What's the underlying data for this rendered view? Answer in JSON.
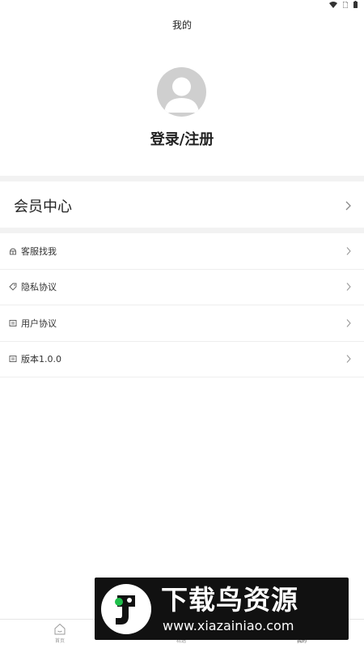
{
  "header": {
    "title": "我的"
  },
  "profile": {
    "login_label": "登录/注册"
  },
  "member": {
    "label": "会员中心"
  },
  "menu": {
    "items": [
      {
        "label": "客服找我",
        "icon": "customer-service-icon"
      },
      {
        "label": "隐私协议",
        "icon": "tag-icon"
      },
      {
        "label": "用户协议",
        "icon": "document-icon"
      },
      {
        "label": "版本1.0.0",
        "icon": "document-icon"
      }
    ]
  },
  "bottom_nav": {
    "items": [
      {
        "label": "首页",
        "icon": "home-icon"
      },
      {
        "label": "精选",
        "icon": "library-icon"
      },
      {
        "label": "我的",
        "icon": "user-icon",
        "active": true
      }
    ]
  },
  "watermark": {
    "title": "下载鸟资源",
    "url": "www.xiazainiao.com"
  },
  "colors": {
    "background": "#ffffff",
    "divider": "#f2f2f2",
    "text": "#222222",
    "muted": "#999999",
    "avatar": "#cfcfcf"
  }
}
